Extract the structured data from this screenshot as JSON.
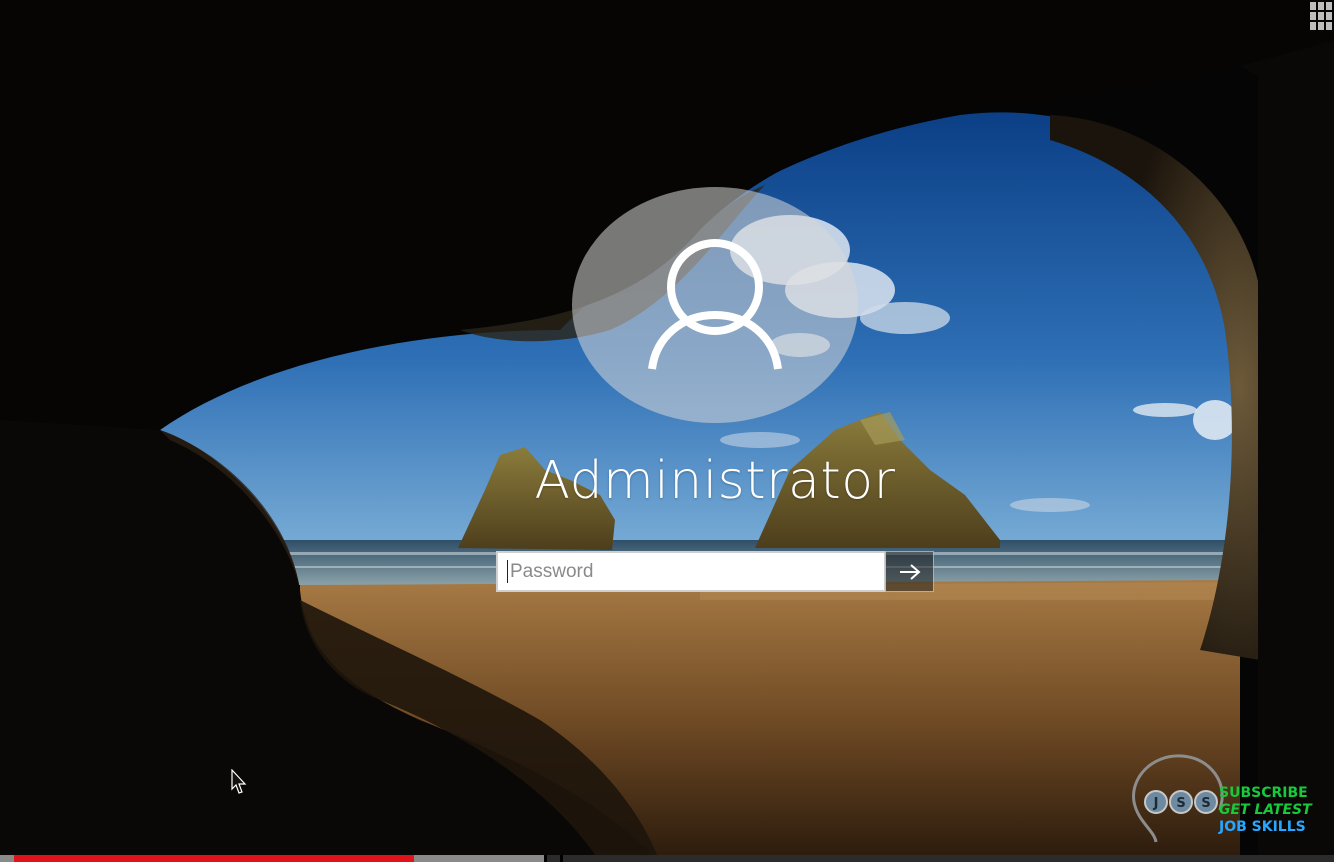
{
  "lock_screen": {
    "user_name": "Administrator",
    "password_placeholder": "Password",
    "submit_icon": "arrow-right-icon",
    "avatar_icon": "user-icon"
  },
  "watermark": {
    "line1": "SUBSCRIBE",
    "line2": "GET LATEST",
    "line3": "JOB SKILLS",
    "logo_letters": [
      "J",
      "S",
      "S"
    ]
  },
  "video_player": {
    "played_fraction": 0.3,
    "buffered_fraction": 0.41
  },
  "colors": {
    "watermark_green": "#18c93c",
    "watermark_blue": "#27a7ff",
    "progress_red": "#e0121a"
  }
}
